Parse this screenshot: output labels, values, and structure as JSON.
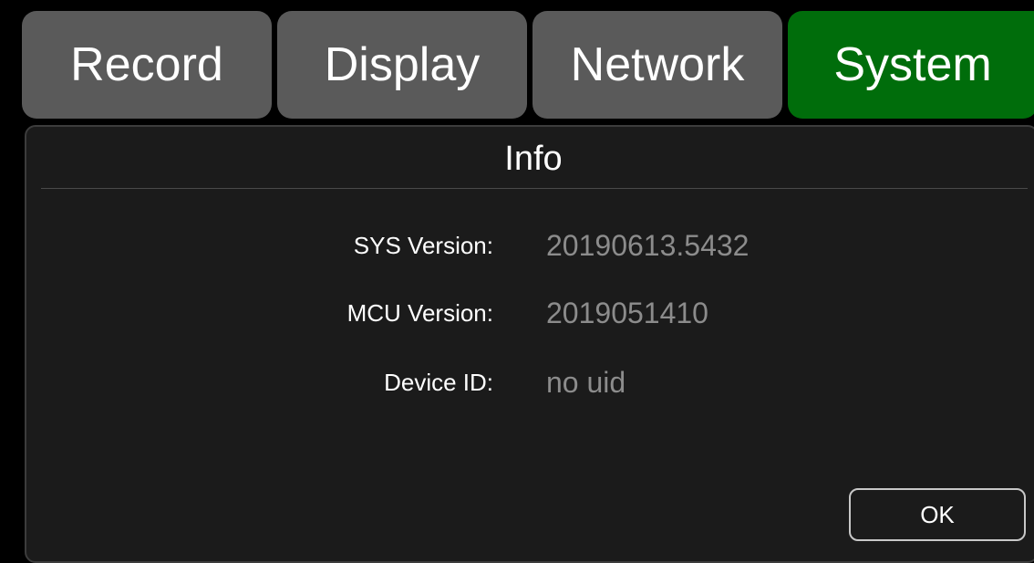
{
  "tabs": [
    {
      "label": "Record",
      "active": false
    },
    {
      "label": "Display",
      "active": false
    },
    {
      "label": "Network",
      "active": false
    },
    {
      "label": "System",
      "active": true
    }
  ],
  "colors": {
    "tab_inactive": "#5a5a5a",
    "tab_active": "#006d0b",
    "panel_background": "#1b1b1b",
    "value_text": "#8c8c8c"
  },
  "info": {
    "title": "Info",
    "rows": [
      {
        "label": "SYS Version:",
        "value": "20190613.5432"
      },
      {
        "label": "MCU Version:",
        "value": "2019051410"
      },
      {
        "label": "Device ID:",
        "value": "no uid"
      }
    ],
    "ok_label": "OK"
  }
}
